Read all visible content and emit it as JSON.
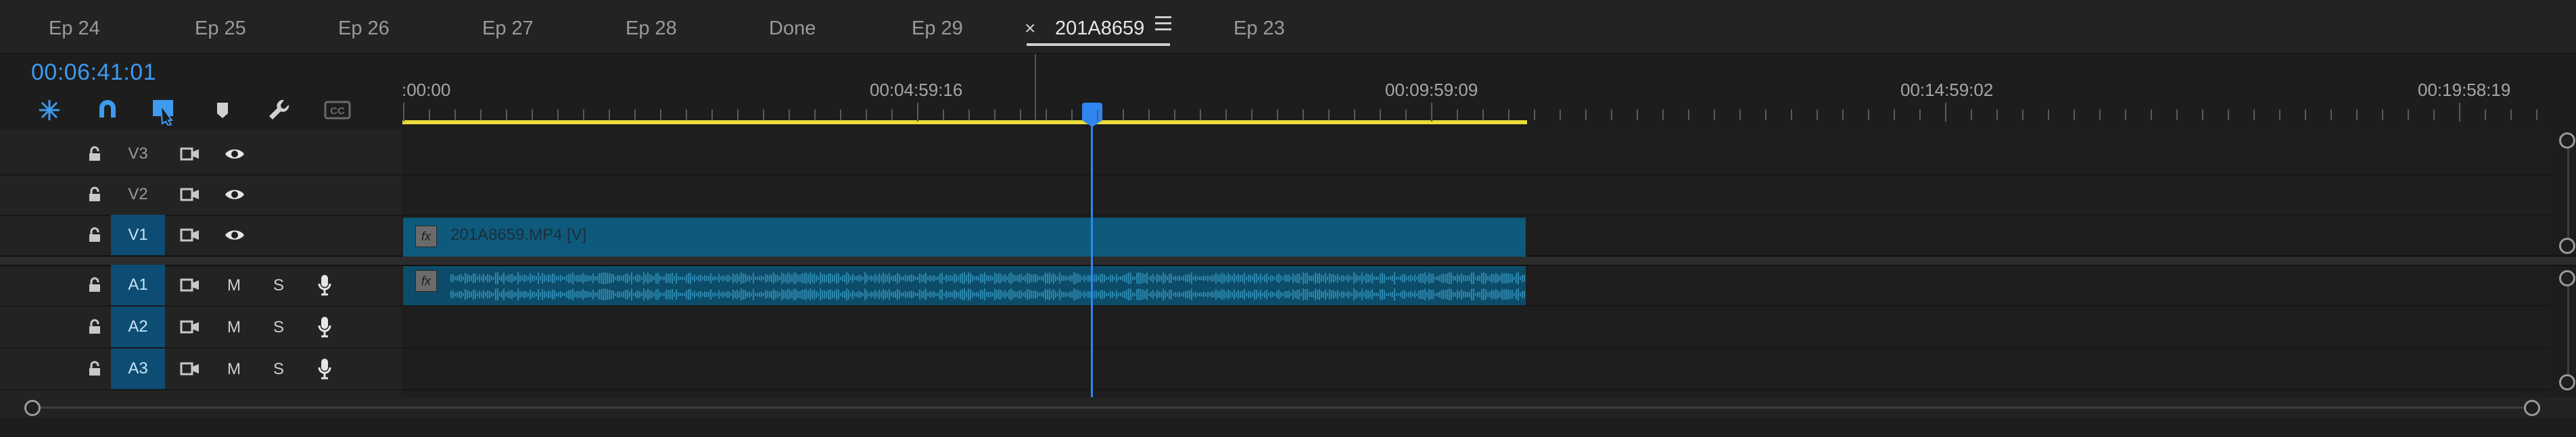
{
  "tabs": [
    {
      "label": "Ep 24"
    },
    {
      "label": "Ep 25"
    },
    {
      "label": "Ep 26"
    },
    {
      "label": "Ep 27"
    },
    {
      "label": "Ep 28"
    },
    {
      "label": "Done"
    },
    {
      "label": "Ep 29"
    },
    {
      "label": "201A8659",
      "active": true
    },
    {
      "label": "Ep 23"
    }
  ],
  "tab_close_glyph": "×",
  "tab_menu_icon": "hamburger-menu-icon",
  "timecode": "00:06:41:01",
  "toolbar": {
    "icons": [
      "insert-overwrite-icon",
      "snap-magnet-icon",
      "linked-selection-icon",
      "add-marker-icon",
      "settings-wrench-icon",
      "captions-icon"
    ],
    "captions_label": "CC"
  },
  "ruler": {
    "labels": [
      ":00:00",
      "00:04:59:16",
      "00:09:59:09",
      "00:14:59:02",
      "00:19:58:19"
    ]
  },
  "tracks": {
    "video": [
      {
        "name": "V3",
        "targeted": false
      },
      {
        "name": "V2",
        "targeted": false
      },
      {
        "name": "V1",
        "targeted": true
      }
    ],
    "audio": [
      {
        "name": "A1",
        "targeted": true,
        "mute": "M",
        "solo": "S"
      },
      {
        "name": "A2",
        "targeted": true,
        "mute": "M",
        "solo": "S"
      },
      {
        "name": "A3",
        "targeted": true,
        "mute": "M",
        "solo": "S"
      }
    ]
  },
  "clips": {
    "video_clip": {
      "label": "201A8659.MP4 [V]",
      "fx": "fx"
    },
    "audio_clip": {
      "fx": "fx"
    }
  },
  "colors": {
    "accent": "#2f86f0",
    "timecode": "#3d9bf0",
    "work_area": "#e8dc3a",
    "clip_video": "#0e5a7c",
    "clip_audio": "#0c4c68",
    "track_target": "#0d4d73"
  }
}
